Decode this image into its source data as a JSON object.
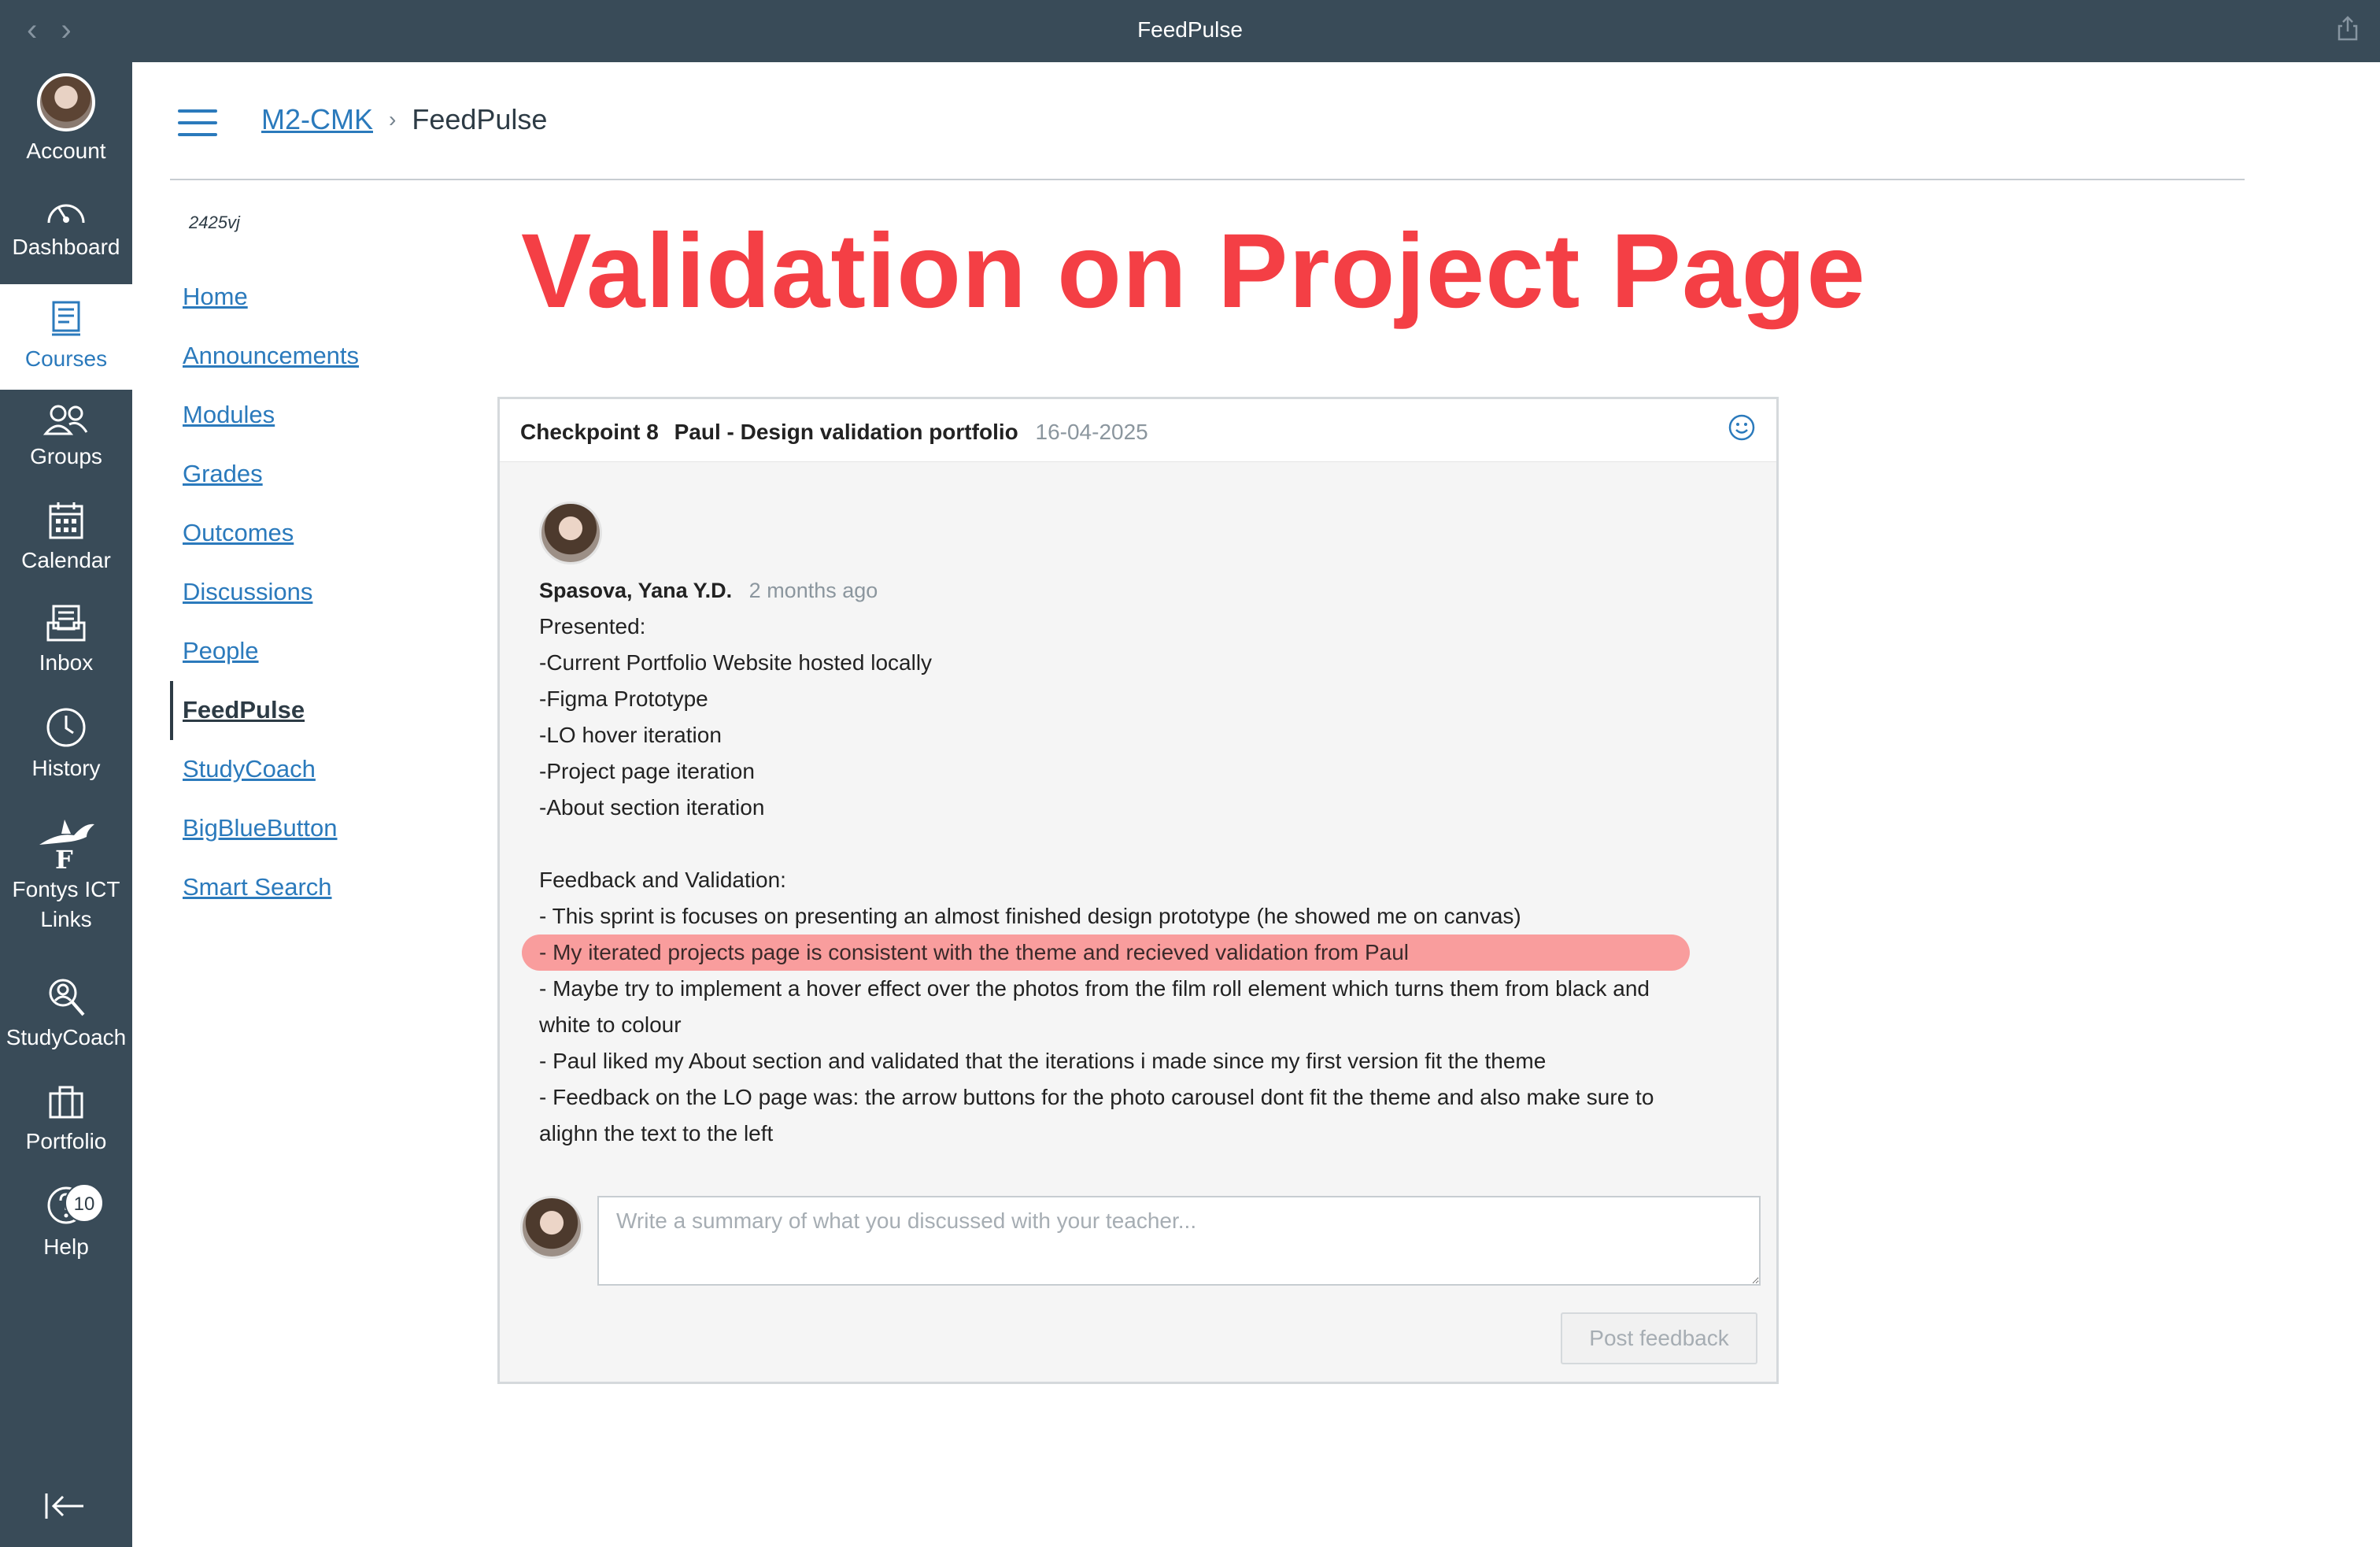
{
  "window": {
    "title": "FeedPulse"
  },
  "global_nav": {
    "items": [
      {
        "label": "Account",
        "icon": "account-avatar"
      },
      {
        "label": "Dashboard",
        "icon": "dashboard-icon"
      },
      {
        "label": "Courses",
        "icon": "courses-icon"
      },
      {
        "label": "Groups",
        "icon": "groups-icon"
      },
      {
        "label": "Calendar",
        "icon": "calendar-icon"
      },
      {
        "label": "Inbox",
        "icon": "inbox-icon"
      },
      {
        "label": "History",
        "icon": "history-icon"
      },
      {
        "label": "Fontys ICT Links",
        "icon": "fontys-icon"
      },
      {
        "label": "StudyCoach",
        "icon": "studycoach-icon"
      },
      {
        "label": "Portfolio",
        "icon": "portfolio-icon"
      },
      {
        "label": "Help",
        "icon": "help-icon",
        "badge": "10"
      }
    ]
  },
  "breadcrumb": {
    "course": "M2-CMK",
    "current": "FeedPulse"
  },
  "course_nav": {
    "code": "2425vj",
    "items": [
      "Home",
      "Announcements",
      "Modules",
      "Grades",
      "Outcomes",
      "Discussions",
      "People",
      "FeedPulse",
      "StudyCoach",
      "BigBlueButton",
      "Smart Search"
    ],
    "active": "FeedPulse"
  },
  "heading": "Validation on Project Page",
  "checkpoint": {
    "number": "Checkpoint 8",
    "title": "Paul - Design validation portfolio",
    "date": "16-04-2025"
  },
  "comment": {
    "author": "Spasova, Yana Y.D.",
    "time": "2 months ago",
    "lines": [
      "Presented:",
      "-Current Portfolio Website hosted locally",
      "-Figma Prototype",
      "-LO hover iteration",
      "-Project page iteration",
      "-About section iteration",
      "",
      "Feedback and Validation:",
      "- This sprint is focuses on presenting an almost finished design prototype (he showed me on canvas)",
      "- My iterated projects page is consistent with the theme and recieved validation from Paul",
      "- Maybe try to implement a hover effect over the photos from the film roll element which turns them from black and",
      "white to colour",
      "- Paul liked my About section and validated that the iterations i made since my first version fit the theme",
      "- Feedback on the LO page was: the arrow buttons for the photo carousel dont fit the theme and also make sure to",
      "alighn the text to the left"
    ]
  },
  "reply": {
    "placeholder": "Write a summary of what you discussed with your teacher...",
    "value": "",
    "post_label": "Post feedback"
  },
  "colors": {
    "nav_bg": "#394b58",
    "link": "#2b7abc",
    "heading": "#f43f45",
    "highlight": "#f99d9d"
  }
}
